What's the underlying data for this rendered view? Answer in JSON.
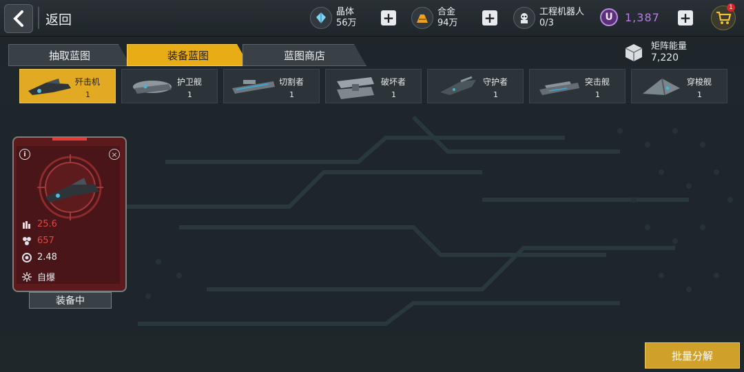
{
  "header": {
    "back_label": "返回",
    "resources": [
      {
        "name": "晶体",
        "value": "56万",
        "icon": "crystal-icon"
      },
      {
        "name": "合金",
        "value": "94万",
        "icon": "alloy-icon"
      },
      {
        "name": "工程机器人",
        "value": "0/3",
        "icon": "robot-icon"
      }
    ],
    "premium_currency": {
      "icon_letter": "U",
      "value": "1,387"
    },
    "cart_badge": "1"
  },
  "tabs": [
    {
      "label": "抽取蓝图",
      "active": false
    },
    {
      "label": "装备蓝图",
      "active": true
    },
    {
      "label": "蓝图商店",
      "active": false
    }
  ],
  "matrix_energy": {
    "label": "矩阵能量",
    "value": "7,220"
  },
  "ship_types": [
    {
      "name": "歼击机",
      "count": "1",
      "active": true
    },
    {
      "name": "护卫舰",
      "count": "1",
      "active": false
    },
    {
      "name": "切割者",
      "count": "1",
      "active": false
    },
    {
      "name": "破坏者",
      "count": "1",
      "active": false
    },
    {
      "name": "守护者",
      "count": "1",
      "active": false
    },
    {
      "name": "突击舰",
      "count": "1",
      "active": false
    },
    {
      "name": "穿梭舰",
      "count": "1",
      "active": false
    }
  ],
  "blueprint_card": {
    "stats": [
      {
        "icon": "ammo-icon",
        "value": "25.6",
        "color": "#e0473f"
      },
      {
        "icon": "hexagon-cluster-icon",
        "value": "657",
        "color": "#e0473f"
      },
      {
        "icon": "gear-ring-icon",
        "value": "2.48",
        "color": "#e6ecef"
      }
    ],
    "skill": {
      "icon": "burst-icon",
      "label": "自爆"
    },
    "status_label": "装备中"
  },
  "bulk_button_label": "批量分解",
  "colors": {
    "accent": "#e8ac17",
    "card_red": "#5c1a1c",
    "stat_red": "#e0473f",
    "premium": "#b77ee6"
  }
}
